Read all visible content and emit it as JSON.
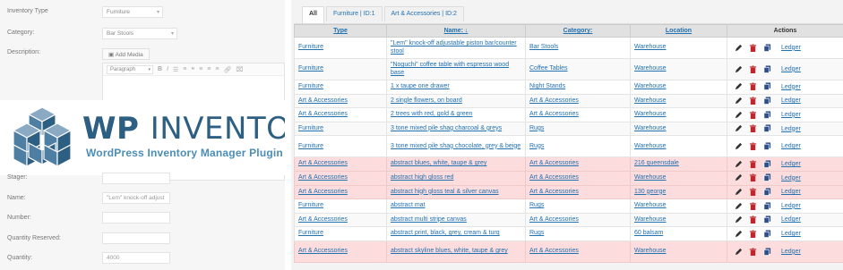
{
  "form": {
    "inventory_type_label": "Inventory Type",
    "inventory_type_value": "Furniture",
    "category_label": "Category:",
    "category_value": "Bar Stools",
    "description_label": "Description:",
    "add_media_label": "Add Media",
    "paragraph_format": "Paragraph",
    "stager_label": "Stager:",
    "name_label": "Name:",
    "name_value": "\"Lem\" knock-off adjust",
    "number_label": "Number:",
    "quantity_reserved_label": "Quantity Reserved:",
    "quantity_label": "Quantity:",
    "quantity_value": "4000"
  },
  "logo": {
    "title_bold": "WP",
    "title_rest": "INVENTORY",
    "subtitle": "WordPress Inventory Manager Plugin"
  },
  "tabs": [
    "All",
    "Furniture | ID:1",
    "Art & Accessories | ID:2"
  ],
  "table": {
    "headers": {
      "type": "Type",
      "name": "Name: ↓",
      "category": "Category:",
      "location": "Location",
      "actions": "Actions"
    },
    "ledger_label": "Ledger",
    "rows": [
      {
        "type": "Furniture",
        "name": "\"Lem\" knock-off adjustable piston bar/counter stool",
        "category": "Bar Stools",
        "location": "Warehouse",
        "highlight": false
      },
      {
        "type": "Furniture",
        "name": "\"Noguchi\" coffee table with espresso wood base",
        "category": "Coffee Tables",
        "location": "Warehouse",
        "highlight": false
      },
      {
        "type": "Furniture",
        "name": "1 x taupe one drawer",
        "category": "Night Stands",
        "location": "Warehouse",
        "highlight": false
      },
      {
        "type": "Art & Accessories",
        "name": "2 single flowers, on board",
        "category": "Art & Accessories",
        "location": "Warehouse",
        "highlight": false
      },
      {
        "type": "Art & Accessories",
        "name": "2 trees with red, gold & green",
        "category": "Art & Accessories",
        "location": "Warehouse",
        "highlight": false
      },
      {
        "type": "Furniture",
        "name": "3 tone mixed pile shag charcoal & greys",
        "category": "Rugs",
        "location": "Warehouse",
        "highlight": false
      },
      {
        "type": "Furniture",
        "name": "3 tone mixed pile shag chocolate, grey & beige",
        "category": "Rugs",
        "location": "Warehouse",
        "highlight": false
      },
      {
        "type": "Art & Accessories",
        "name": "abstract blues, white, taupe & grey",
        "category": "Art & Accessories",
        "location": "216 queensdale",
        "highlight": true
      },
      {
        "type": "Art & Accessories",
        "name": "abstract high gloss red",
        "category": "Art & Accessories",
        "location": "Warehouse",
        "highlight": true
      },
      {
        "type": "Art & Accessories",
        "name": "abstract high gloss teal & silver canvas",
        "category": "Art & Accessories",
        "location": "130 george",
        "highlight": true
      },
      {
        "type": "Furniture",
        "name": "abstract mat",
        "category": "Rugs",
        "location": "Warehouse",
        "highlight": false
      },
      {
        "type": "Art & Accessories",
        "name": "abstract multi stripe canvas",
        "category": "Art & Accessories",
        "location": "Warehouse",
        "highlight": false
      },
      {
        "type": "Furniture",
        "name": "abstract print, black, grey, cream & turq",
        "category": "Rugs",
        "location": "60 balsam",
        "highlight": false
      },
      {
        "type": "Art & Accessories",
        "name": "abstract skyline blues, white, taupe & grey",
        "category": "Art & Accessories",
        "location": "Warehouse",
        "highlight": true
      }
    ]
  },
  "colors": {
    "link": "#2271b1",
    "highlight_row": "#fcdcdc",
    "delete_icon": "#c0262c",
    "logo_blue": "#2d5f83"
  },
  "icons": [
    "pencil-icon",
    "trash-icon",
    "copy-icon"
  ]
}
